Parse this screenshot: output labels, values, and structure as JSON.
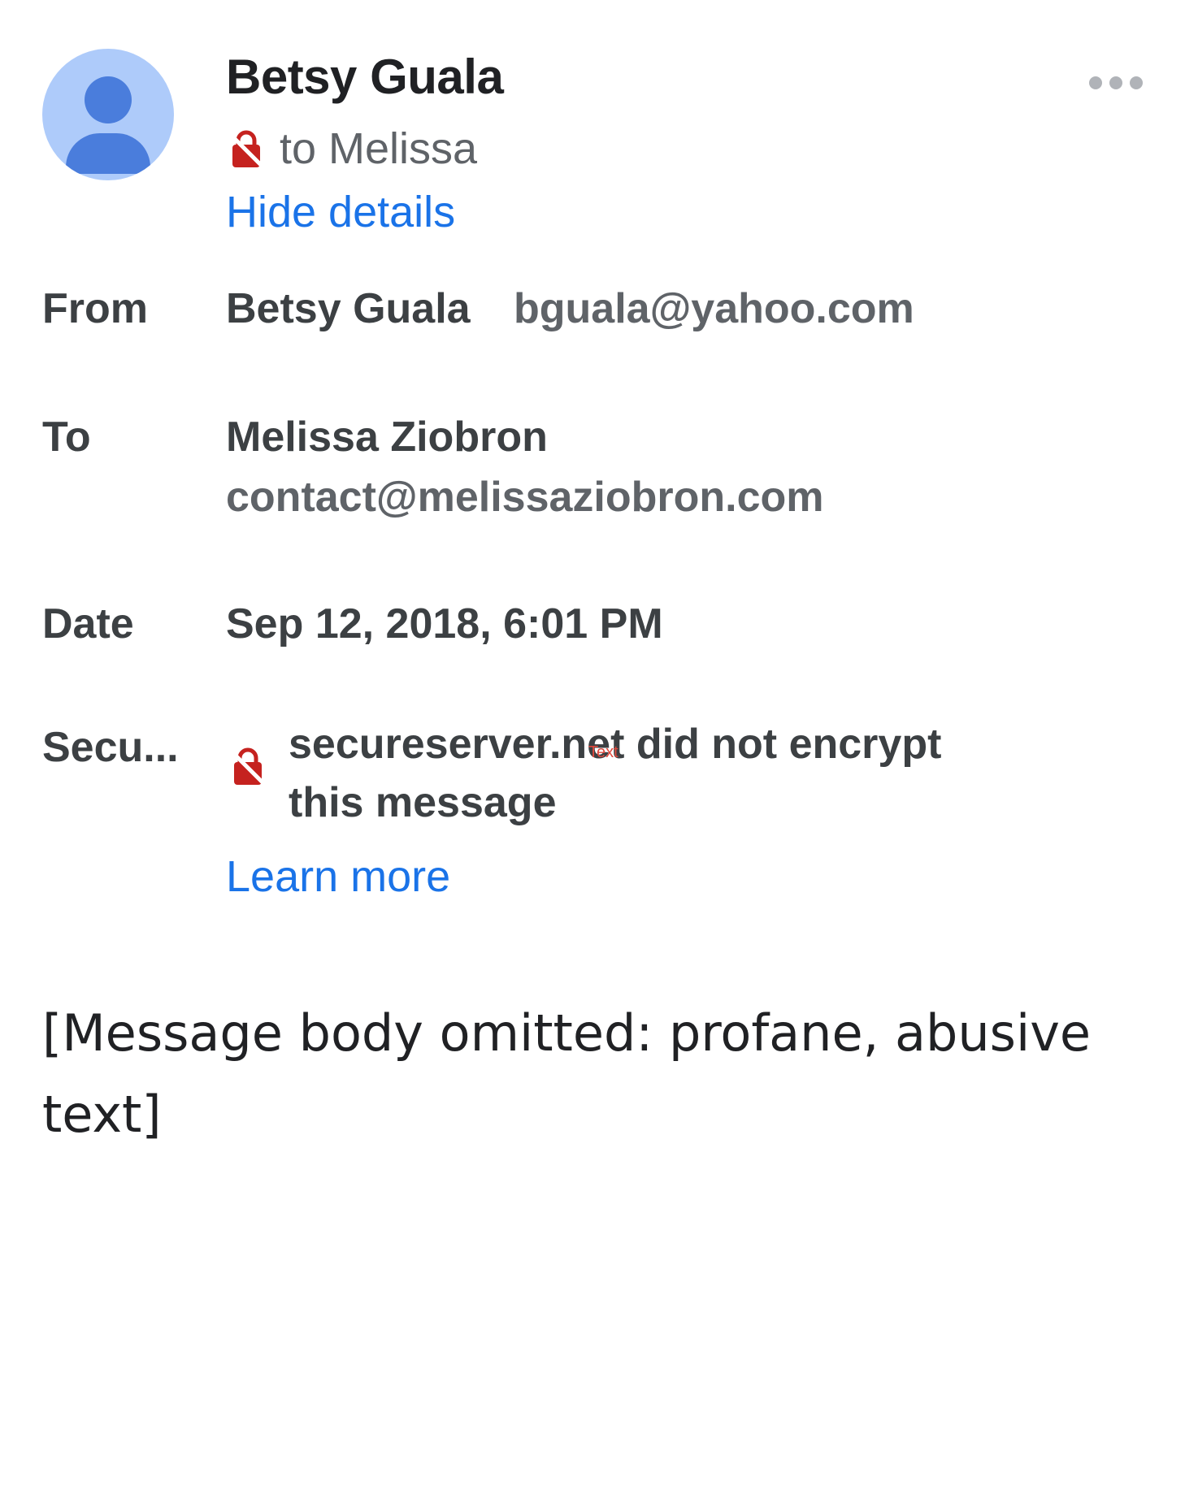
{
  "header": {
    "sender_name": "Betsy Guala",
    "to_line": "to Melissa",
    "hide_details": "Hide details"
  },
  "details": {
    "from_label": "From",
    "from_name": "Betsy Guala",
    "from_email": "bguala@yahoo.com",
    "to_label": "To",
    "to_name": "Melissa Ziobron",
    "to_email": "contact@melissaziobron.com",
    "date_label": "Date",
    "date_value": "Sep 12, 2018, 6:01 PM",
    "security_label": "Secu...",
    "security_text": "secureserver.net did not encrypt this message",
    "learn_more": "Learn more",
    "annotation": "Text"
  },
  "message": {
    "body": "[Message body omitted: profane, abusive text]"
  },
  "icons": {
    "avatar": "person-avatar-icon",
    "lock": "unencrypted-lock-icon",
    "more": "more-options-icon"
  },
  "colors": {
    "link": "#1a73e8",
    "lock_red": "#c5221f",
    "avatar_bg": "#aecbfa",
    "avatar_fg": "#4a7ddc"
  }
}
